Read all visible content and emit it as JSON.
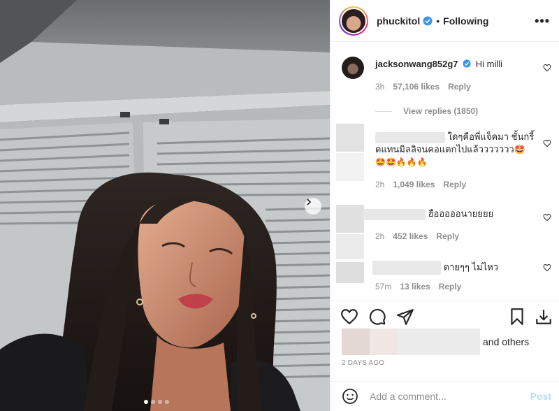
{
  "post": {
    "username": "phuckitol",
    "follow_status": "Following",
    "more_label": "•••",
    "carousel": {
      "slides": 4,
      "active": 0
    }
  },
  "comments": [
    {
      "username": "jacksonwang852g7",
      "text": "Hi milli",
      "time": "3h",
      "likes": "57,106 likes",
      "reply": "Reply",
      "view_replies": "View replies (1850)"
    },
    {
      "text_line1": "ใดๆคือพี่แจ็คมา ชั้นกรี้",
      "text_line2": "ดแทนมิลลิจนคอแตกไปแล้ววววววว🤩",
      "text_line3": "🤩🤩🔥🔥🔥",
      "time": "2h",
      "likes": "1,049 likes",
      "reply": "Reply"
    },
    {
      "text": "ฮือออออนายยยย",
      "time": "2h",
      "likes": "452 likes",
      "reply": "Reply"
    },
    {
      "text": "ตายๆๆ ไม่ไหว",
      "time": "57m",
      "likes": "13 likes",
      "reply": "Reply"
    }
  ],
  "likes_summary": "and others",
  "date": "2 DAYS AGO",
  "comment_box": {
    "placeholder": "Add a comment...",
    "post_label": "Post"
  },
  "colors": {
    "verified": "#3897f0",
    "post_disabled": "#b2dffc",
    "muted": "#8e8e8e"
  }
}
